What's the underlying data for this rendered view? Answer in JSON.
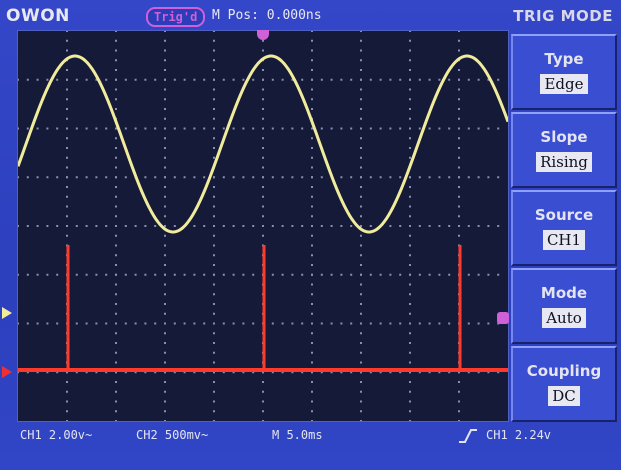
{
  "header": {
    "brand": "OWON",
    "trigger_status": "Trig'd",
    "m_pos": "M Pos: 0.000ns",
    "menu_title": "TRIG MODE"
  },
  "menu": {
    "items": [
      {
        "label": "Type",
        "value": "Edge"
      },
      {
        "label": "Slope",
        "value": "Rising"
      },
      {
        "label": "Source",
        "value": "CH1"
      },
      {
        "label": "Mode",
        "value": "Auto"
      },
      {
        "label": "Coupling",
        "value": "DC"
      }
    ]
  },
  "status": {
    "ch1_scale": "CH1 2.00v~",
    "ch2_scale": "CH2 500mv~",
    "timebase": "M 5.0ms",
    "trigger_info": "CH1 2.24v"
  },
  "colors": {
    "ch1": "#f0ec9c",
    "ch2": "#ff3a2a",
    "trigger": "#d060d8",
    "grid_dots": "#8a8fb0"
  },
  "icons": {
    "slope": "rising-edge-icon"
  }
}
